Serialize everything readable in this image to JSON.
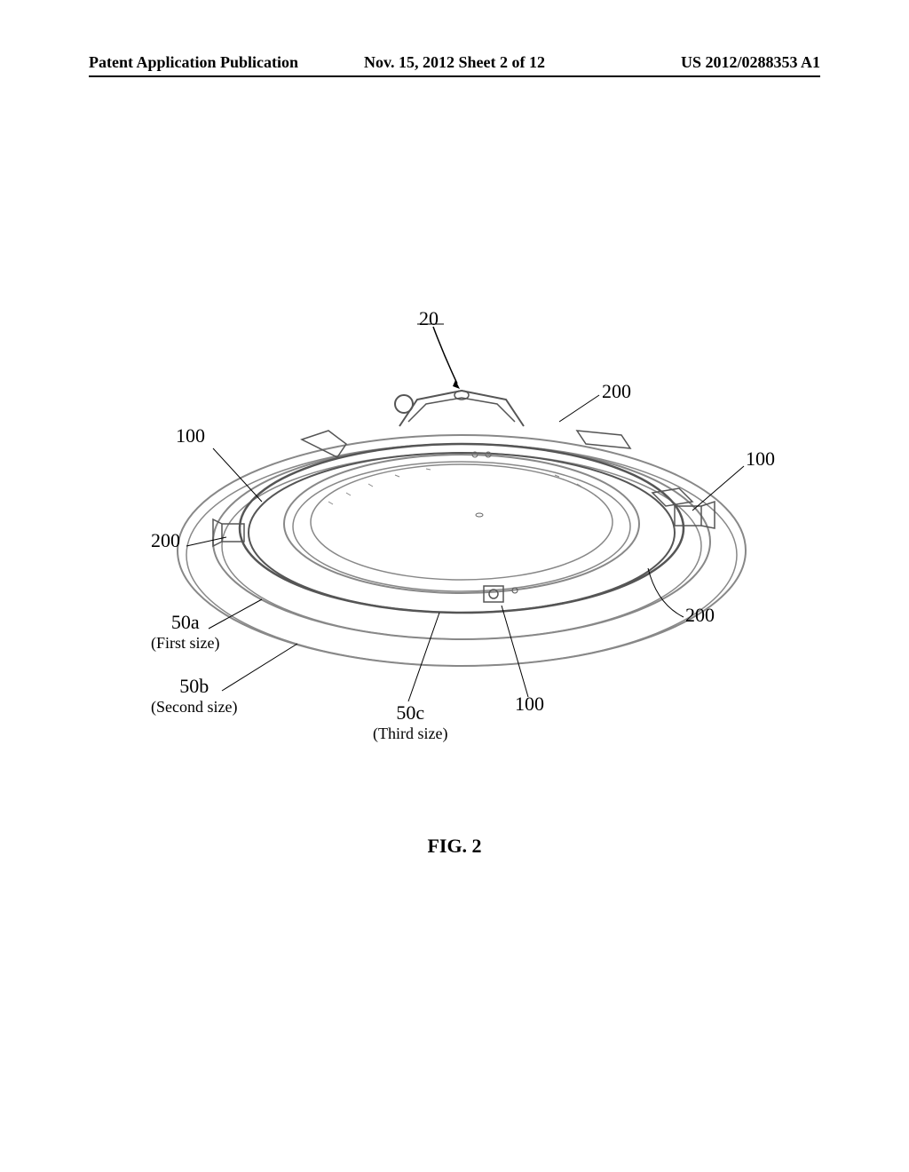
{
  "header": {
    "left": "Patent Application Publication",
    "center": "Nov. 15, 2012  Sheet 2 of 12",
    "right": "US 2012/0288353 A1"
  },
  "figure": {
    "caption": "FIG. 2",
    "labels": {
      "ref_20": "20",
      "ref_200_top": "200",
      "ref_100_left": "100",
      "ref_100_right": "100",
      "ref_200_left": "200",
      "ref_200_right": "200",
      "ref_50a": "50a",
      "ref_50a_sub": "(First size)",
      "ref_50b": "50b",
      "ref_50b_sub": "(Second size)",
      "ref_50c": "50c",
      "ref_50c_sub": "(Third size)",
      "ref_100_bottom": "100"
    }
  }
}
